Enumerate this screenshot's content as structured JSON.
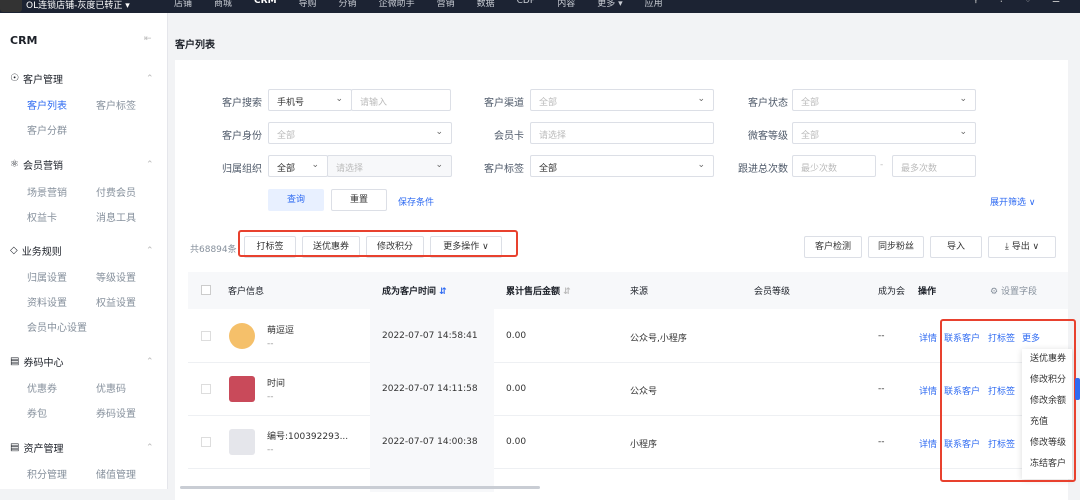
{
  "topbar": {
    "shop": "OL连锁店铺-灰度已转正 ▾",
    "nav": [
      "店铺",
      "商城",
      "CRM",
      "导购",
      "分销",
      "企微助手",
      "营销",
      "数据",
      "CDP",
      "内容",
      "更多 ▾",
      "应用"
    ],
    "active": "CRM"
  },
  "sidebar": {
    "title": "CRM",
    "groups": [
      {
        "label": "客户管理",
        "items": [
          "客户列表",
          "客户标签",
          "客户分群"
        ]
      },
      {
        "label": "会员营销",
        "items": [
          "场景营销",
          "付费会员",
          "权益卡",
          "消息工具"
        ]
      },
      {
        "label": "业务规则",
        "items": [
          "归属设置",
          "等级设置",
          "资料设置",
          "权益设置",
          "会员中心设置"
        ]
      },
      {
        "label": "券码中心",
        "items": [
          "优惠券",
          "优惠码",
          "券包",
          "券码设置"
        ]
      },
      {
        "label": "资产管理",
        "items": [
          "积分管理",
          "储值管理"
        ]
      }
    ]
  },
  "page_title": "客户列表",
  "filters": {
    "search_label": "客户搜索",
    "search_type": "手机号",
    "search_placeholder": "请输入",
    "channel_label": "客户渠道",
    "channel_value": "全部",
    "status_label": "客户状态",
    "status_value": "全部",
    "identity_label": "客户身份",
    "identity_value": "全部",
    "card_label": "会员卡",
    "card_placeholder": "请选择",
    "wlevel_label": "微客等级",
    "wlevel_value": "全部",
    "org_label": "归属组织",
    "org_value": "全部",
    "org_placeholder": "请选择",
    "tag_label": "客户标签",
    "tag_value": "全部",
    "follow_label": "跟进总次数",
    "follow_min": "最少次数",
    "follow_sep": "-",
    "follow_max": "最多次数",
    "query": "查询",
    "reset": "重置",
    "save": "保存条件",
    "expand": "展开筛选 ∨"
  },
  "toolbar": {
    "count": "共68894条",
    "batch": [
      "打标签",
      "送优惠券",
      "修改积分",
      "更多操作 ∨"
    ],
    "right": [
      "客户检测",
      "同步粉丝",
      "导入",
      "导出 ∨"
    ]
  },
  "table": {
    "headers": [
      "客户信息",
      "成为客户时间",
      "累计售后金额",
      "来源",
      "会员等级",
      "成为会",
      "操作",
      "设置字段"
    ],
    "rows": [
      {
        "name": "萌逗逗",
        "sub": "--",
        "time": "2022-07-07 14:58:41",
        "amount": "0.00",
        "source": "公众号,小程序",
        "level": "--"
      },
      {
        "name": "时间",
        "sub": "--",
        "time": "2022-07-07 14:11:58",
        "amount": "0.00",
        "source": "公众号",
        "level": "--"
      },
      {
        "name": "编号:100392293...",
        "sub": "--",
        "time": "2022-07-07 14:00:38",
        "amount": "0.00",
        "source": "小程序",
        "level": "--"
      }
    ],
    "ops": [
      "详情",
      "联系客户",
      "打标签",
      "更多"
    ]
  },
  "more_menu": [
    "送优惠券",
    "修改积分",
    "修改余额",
    "充值",
    "修改等级",
    "冻结客户"
  ]
}
